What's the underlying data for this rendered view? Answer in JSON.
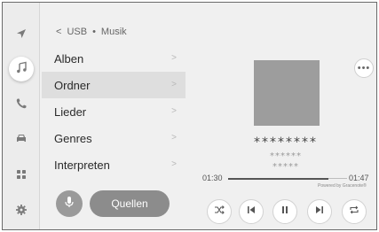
{
  "breadcrumb": {
    "back_symbol": "<",
    "source": "USB",
    "separator": "•",
    "section": "Musik"
  },
  "sidebar": {
    "items": [
      {
        "name": "navigation",
        "icon": "navigation-arrow-icon",
        "active": false
      },
      {
        "name": "music",
        "icon": "music-note-icon",
        "active": true
      },
      {
        "name": "phone",
        "icon": "phone-icon",
        "active": false
      },
      {
        "name": "vehicle",
        "icon": "car-icon",
        "active": false
      },
      {
        "name": "apps",
        "icon": "apps-grid-icon",
        "active": false
      },
      {
        "name": "settings",
        "icon": "gear-icon",
        "active": false
      }
    ]
  },
  "browse_list": {
    "items": [
      {
        "label": "Alben",
        "selected": false
      },
      {
        "label": "Ordner",
        "selected": true
      },
      {
        "label": "Lieder",
        "selected": false
      },
      {
        "label": "Genres",
        "selected": false
      },
      {
        "label": "Interpreten",
        "selected": false
      }
    ],
    "chevron": ">"
  },
  "controls_left": {
    "mic_icon": "microphone-icon",
    "sources_label": "Quellen"
  },
  "player": {
    "more_label": "•••",
    "track_title": "********",
    "track_artist": "******",
    "track_album": "*****",
    "time_elapsed": "01:30",
    "time_total": "01:47",
    "progress_fraction": 0.84,
    "powered_by": "Powered by Gracenote®",
    "buttons": [
      "shuffle-icon",
      "previous-track-icon",
      "pause-icon",
      "next-track-icon",
      "repeat-icon"
    ]
  },
  "colors": {
    "background": "#f0f0f0",
    "selected_row": "#dedede",
    "album_art": "#9d9d9d",
    "sources_button": "#8c8c8c",
    "mic_button": "#9a9a9a",
    "icon": "#7a7a7a"
  }
}
